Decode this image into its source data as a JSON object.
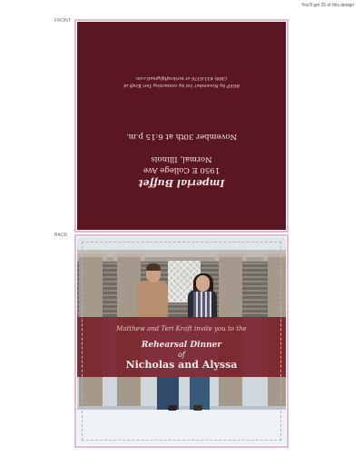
{
  "note": "You'll get 25 of this design",
  "labels": {
    "front": "FRONT",
    "back": "BACK"
  },
  "front": {
    "venue": "Imperial Buffet",
    "address_line1": "1950 E College Ave",
    "address_line2": "Normal, Illinois",
    "date_time": "November 30th at 6:15 p.m.",
    "rsvp_line1": "RSVP by November 1st by contacting Teri Kraft at",
    "rsvp_line2": "(309) 433.6376 or terikraft@gmail.com"
  },
  "back": {
    "invite_line": "Matthew and Teri Kraft invite you to the",
    "event_title": "Rehearsal Dinner",
    "of": "of",
    "names": "Nicholas and Alyssa"
  },
  "colors": {
    "card_maroon": "#5a1722",
    "banner_maroon": "#78222b",
    "outline_pink": "#e7b9cf"
  }
}
